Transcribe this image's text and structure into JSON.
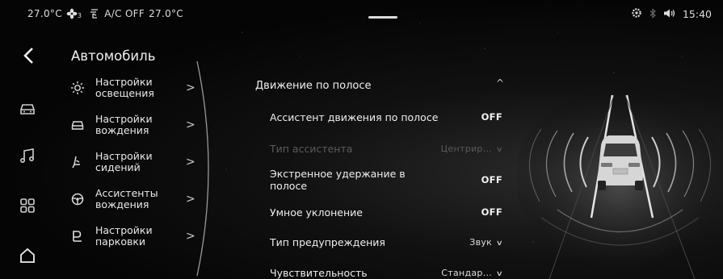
{
  "status_bar": {
    "temp_left": "27.0°C",
    "fan_level": "3",
    "ac_status": "A/C OFF",
    "temp_right": "27.0°C",
    "time": "15:40"
  },
  "page": {
    "title": "Автомобиль"
  },
  "menu": {
    "items": [
      {
        "label": "Настройки освещения",
        "icon": "sun-icon"
      },
      {
        "label": "Настройки вождения",
        "icon": "car-icon"
      },
      {
        "label": "Настройки сидений",
        "icon": "seat-icon"
      },
      {
        "label": "Ассистенты вождения",
        "icon": "steering-wheel-icon"
      },
      {
        "label": "Настройки парковки",
        "icon": "parking-icon"
      }
    ],
    "arrow": ">"
  },
  "lane": {
    "section_title": "Движение по полосе",
    "section_caret": "^",
    "rows": [
      {
        "label": "Ассистент движения по полосе",
        "value": "OFF"
      },
      {
        "label": "Тип ассистента",
        "value": "Центрир..."
      },
      {
        "label": "Экстренное удержание в полосе",
        "value": "OFF"
      },
      {
        "label": "Умное уклонение",
        "value": "OFF"
      },
      {
        "label": "Тип предупреждения",
        "value": "Звук"
      },
      {
        "label": "Чувствительность",
        "value": "Стандар..."
      }
    ]
  },
  "colors": {
    "accent": "#f0f0f0",
    "disabled": "#5b5b5b",
    "background": "#050505"
  }
}
